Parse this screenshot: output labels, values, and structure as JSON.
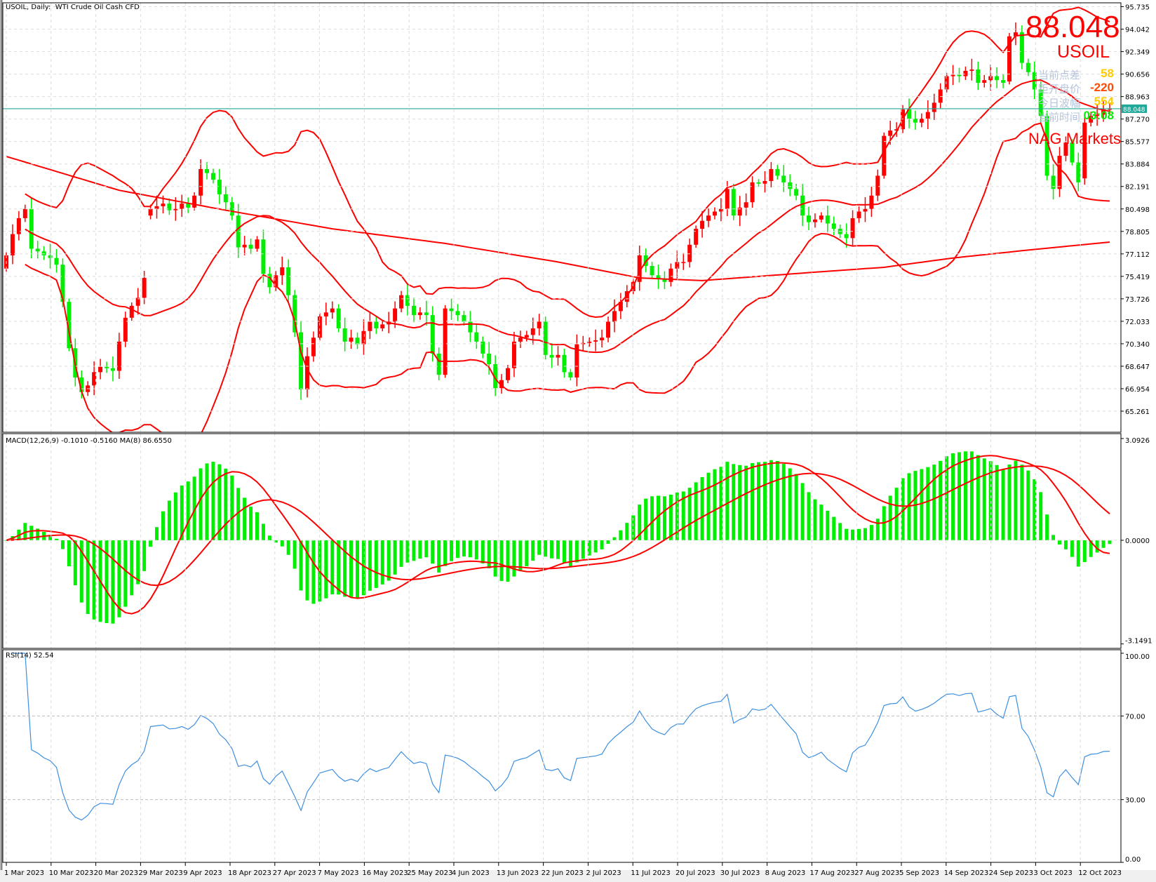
{
  "header": {
    "title": "USOIL, Daily:  WTI Crude Oil Cash CFD"
  },
  "overlay": {
    "price": "88.048",
    "symbol": "USOIL",
    "rows": [
      {
        "label": "当前点差",
        "value": "58",
        "color": "#ffcc00"
      },
      {
        "label": "距开盘价",
        "value": "-220",
        "color": "#ff4a00"
      },
      {
        "label": "今日波幅",
        "value": "554",
        "color": "#ffcc00"
      },
      {
        "label": "当前时间",
        "value": "03:08",
        "color": "#00ee00"
      }
    ],
    "brand": "NAG Markets"
  },
  "colors": {
    "up": "#ff0000",
    "down": "#00ee00",
    "bands": "#ff0000",
    "current_line": "#20a898",
    "rsi": "#3d8fe0",
    "grid": "#dcdcdc"
  },
  "current_price_label": "88.048",
  "chart_data": [
    {
      "type": "candlestick",
      "title": "USOIL, Daily: WTI Crude Oil Cash CFD",
      "ylim": [
        65.261,
        95.735
      ],
      "y_ticks": [
        "95.735",
        "94.042",
        "92.349",
        "90.656",
        "88.963",
        "87.270",
        "85.577",
        "83.884",
        "82.191",
        "80.498",
        "78.805",
        "77.112",
        "75.419",
        "73.726",
        "72.033",
        "70.340",
        "68.647",
        "66.954",
        "65.261"
      ],
      "x_ticks": [
        "1 Mar 2023",
        "10 Mar 2023",
        "20 Mar 2023",
        "29 Mar 2023",
        "9 Apr 2023",
        "18 Apr 2023",
        "27 Apr 2023",
        "7 May 2023",
        "16 May 2023",
        "25 May 2023",
        "4 Jun 2023",
        "13 Jun 2023",
        "22 Jun 2023",
        "2 Jul 2023",
        "11 Jul 2023",
        "20 Jul 2023",
        "30 Jul 2023",
        "8 Aug 2023",
        "17 Aug 2023",
        "27 Aug 2023",
        "5 Sep 2023",
        "14 Sep 2023",
        "24 Sep 2023",
        "3 Oct 2023",
        "12 Oct 2023"
      ],
      "open_first": 76.0,
      "gap_opens": {
        "23": 80.0,
        "160": 90.1,
        "172": 82.8
      },
      "close": [
        77.0,
        78.6,
        79.8,
        80.5,
        77.5,
        77.3,
        77.0,
        76.8,
        76.3,
        73.5,
        70.0,
        67.8,
        66.7,
        67.2,
        68.2,
        68.6,
        68.5,
        68.3,
        70.5,
        72.3,
        73.2,
        73.8,
        75.3,
        80.5,
        80.7,
        80.9,
        80.4,
        80.5,
        80.9,
        80.6,
        81.5,
        83.5,
        83.2,
        82.7,
        81.6,
        81.0,
        80.0,
        77.6,
        77.8,
        77.5,
        78.2,
        75.6,
        74.6,
        75.5,
        76.1,
        74.0,
        71.2,
        66.9,
        69.4,
        70.8,
        72.4,
        72.7,
        73.0,
        71.5,
        70.5,
        70.8,
        70.3,
        71.3,
        72.0,
        71.5,
        71.8,
        72.0,
        73.0,
        74.0,
        73.2,
        72.5,
        72.7,
        72.5,
        69.6,
        68.0,
        73.0,
        72.8,
        72.5,
        72.0,
        71.2,
        70.5,
        69.6,
        68.8,
        67.0,
        67.6,
        68.5,
        70.5,
        70.8,
        71.0,
        71.5,
        72.0,
        69.5,
        69.3,
        69.5,
        68.2,
        67.8,
        70.3,
        70.4,
        70.5,
        70.6,
        70.8,
        72.0,
        72.8,
        73.5,
        74.3,
        75.0,
        77.0,
        76.2,
        75.5,
        75.2,
        75.0,
        76.0,
        76.5,
        76.5,
        77.8,
        79.0,
        79.6,
        80.0,
        80.3,
        80.5,
        82.0,
        80.0,
        80.6,
        81.0,
        82.5,
        82.4,
        82.6,
        83.5,
        83.0,
        82.5,
        82.0,
        81.5,
        80.0,
        79.5,
        79.7,
        80.0,
        79.4,
        79.0,
        78.6,
        78.3,
        79.8,
        80.3,
        80.5,
        81.5,
        83.0,
        86.0,
        86.4,
        86.5,
        88.0,
        87.3,
        87.0,
        87.3,
        87.8,
        88.5,
        89.5,
        90.5,
        90.6,
        90.5,
        90.9,
        91.0,
        90.0,
        90.2,
        90.5,
        90.2,
        90.0,
        93.5,
        93.8,
        91.5,
        90.8,
        89.5,
        87.5,
        83.0,
        82.0,
        84.5,
        85.5,
        84.0,
        82.5,
        87.0,
        87.5,
        87.6,
        88.0,
        88.048
      ],
      "current_price": 88.048,
      "bollinger": {
        "period": 20,
        "deviation": 2
      },
      "ma_long": [
        [
          0,
          84.45
        ],
        [
          18,
          81.9
        ],
        [
          35,
          80.4
        ],
        [
          52,
          79.0
        ],
        [
          70,
          77.9
        ],
        [
          88,
          76.5
        ],
        [
          101,
          75.3
        ],
        [
          111,
          75.1
        ],
        [
          128,
          75.7
        ],
        [
          140,
          76.1
        ],
        [
          151,
          76.8
        ],
        [
          163,
          77.4
        ],
        [
          176,
          78.0
        ]
      ]
    },
    {
      "type": "bar+line",
      "title": "MACD(12,26,9) -0.1010 -0.5160 MA(8) 86.6550",
      "ylim": [
        -3.1491,
        3.0926
      ],
      "y_ticks": [
        "3.0926",
        "0.0000",
        "-3.1491"
      ],
      "params": {
        "fast": 12,
        "slow": 26,
        "signal": 9,
        "ma": 8
      },
      "last_values": {
        "main": -0.101,
        "signal": -0.516,
        "ma": 86.655
      }
    },
    {
      "type": "line",
      "title": "RSI(14) 52.54",
      "period": 14,
      "ylim": [
        0,
        100
      ],
      "y_ticks": [
        "100.00",
        "70.00",
        "30.00",
        "0.00"
      ],
      "levels": [
        70,
        30
      ],
      "last_value": 52.54
    }
  ]
}
